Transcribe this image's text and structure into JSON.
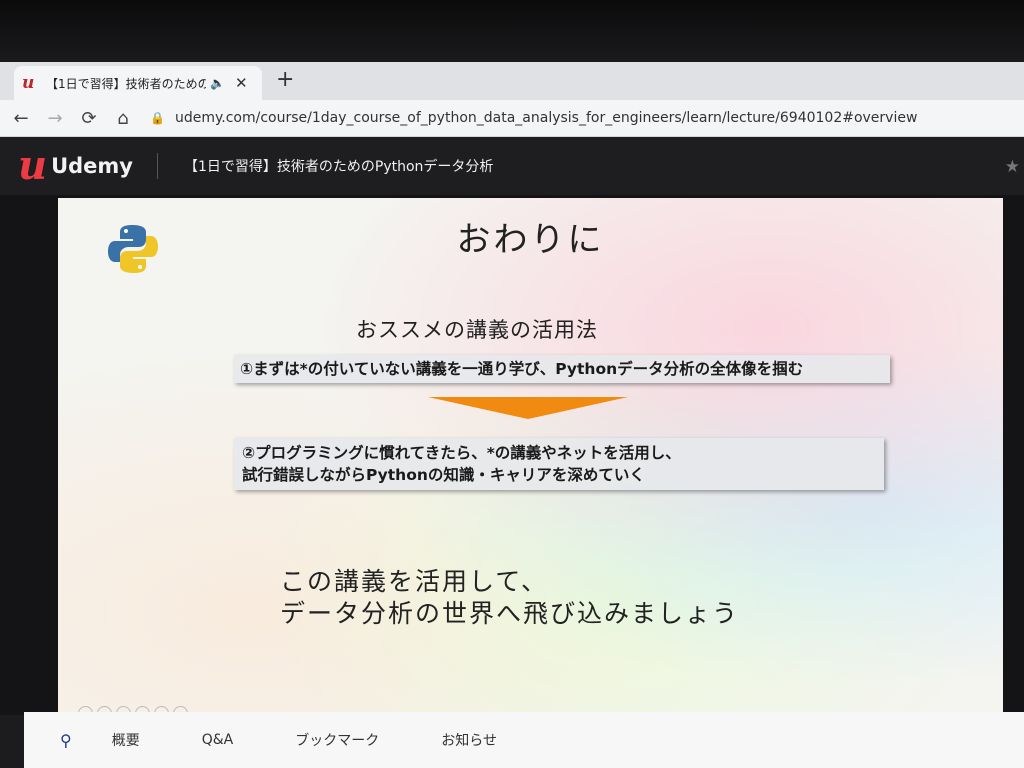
{
  "browser": {
    "tab_title": "【1日で習得】技術者のためのPy",
    "url": "udemy.com/course/1day_course_of_python_data_analysis_for_engineers/learn/lecture/6940102#overview"
  },
  "header": {
    "brand": "Udemy",
    "course_title": "【1日で習得】技術者のためのPythonデータ分析"
  },
  "slide": {
    "title": "おわりに",
    "section_title": "おススメの講義の活用法",
    "step1": "①まずは*の付いていない講義を一通り学び、Pythonデータ分析の全体像を掴む",
    "step2_line1": "②プログラミングに慣れてきたら、*の講義やネットを活用し、",
    "step2_line2": "試行錯誤しながらPythonの知識・キャリアを深めていく",
    "closing_line1": "この講義を活用して、",
    "closing_line2": "データ分析の世界へ飛び込みましょう"
  },
  "bottom_tabs": [
    "概要",
    "Q&A",
    "ブックマーク",
    "お知らせ"
  ],
  "icons": {
    "tab_favicon": "u",
    "audio": "🔈",
    "close": "✕",
    "new_tab": "+",
    "back": "←",
    "forward": "→",
    "reload": "⟳",
    "home": "⌂",
    "lock": "🔒",
    "star": "★",
    "search": "⚲"
  },
  "colors": {
    "udemy_red": "#ec3b45",
    "arrow_orange": "#f08a10"
  }
}
